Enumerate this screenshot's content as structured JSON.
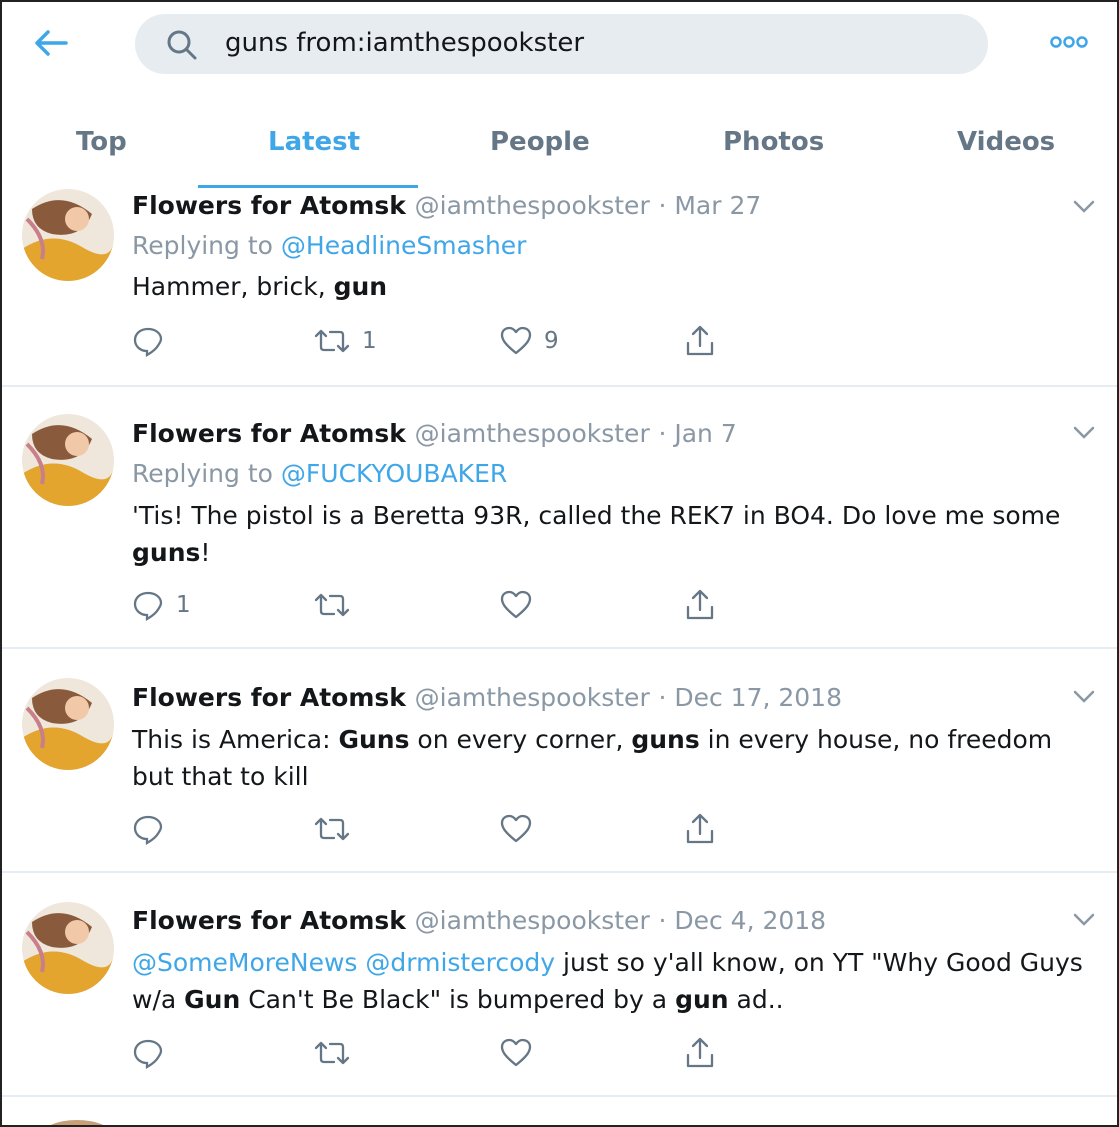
{
  "search": {
    "query": "guns from:iamthespookster"
  },
  "tabs": [
    {
      "label": "Top"
    },
    {
      "label": "Latest"
    },
    {
      "label": "People"
    },
    {
      "label": "Photos"
    },
    {
      "label": "Videos"
    }
  ],
  "active_tab": "Latest",
  "colors": {
    "accent": "#3fa6e8",
    "muted": "#8a98a5",
    "text": "#14171a",
    "search_bg": "#e6ecf0"
  },
  "tweets": [
    {
      "name": "Flowers for Atomsk",
      "handle": "@iamthespookster",
      "date": "· Mar 27",
      "replying_prefix": "Replying to",
      "replying_to": "@HeadlineSmasher",
      "text_1": "Hammer, brick, ",
      "bold_1": "gun",
      "replies": "",
      "retweets": "1",
      "likes": "9"
    },
    {
      "name": "Flowers for Atomsk",
      "handle": "@iamthespookster",
      "date": "· Jan 7",
      "replying_prefix": "Replying to",
      "replying_to": "@FUCKYOUBAKER",
      "text_1": "'Tis! The pistol is a Beretta 93R, called the REK7 in BO4. Do love me some ",
      "bold_1": "guns",
      "text_2": "!",
      "replies": "1",
      "retweets": "",
      "likes": ""
    },
    {
      "name": "Flowers for Atomsk",
      "handle": "@iamthespookster",
      "date": "· Dec 17, 2018",
      "text_1": "This is America: ",
      "bold_1": "Guns",
      "text_2": " on every corner, ",
      "bold_2": "guns",
      "text_3": " in every house, no freedom but that to kill",
      "replies": "",
      "retweets": "",
      "likes": ""
    },
    {
      "name": "Flowers for Atomsk",
      "handle": "@iamthespookster",
      "date": "· Dec 4, 2018",
      "mention_1": "@SomeMoreNews",
      "mention_2": "@drmistercody",
      "text_1": " just so y'all know, on YT \"Why Good Guys w/a ",
      "bold_1": "Gun",
      "text_2": " Can't Be Black\" is bumpered by a ",
      "bold_2": "gun",
      "text_3": " ad..",
      "replies": "",
      "retweets": "",
      "likes": ""
    }
  ],
  "icons": {
    "back": "arrow-left-icon",
    "search": "search-icon",
    "more": "more-dots-icon",
    "caret": "chevron-down-icon",
    "reply": "reply-bubble-icon",
    "retweet": "retweet-icon",
    "like": "heart-icon",
    "share": "share-icon"
  }
}
